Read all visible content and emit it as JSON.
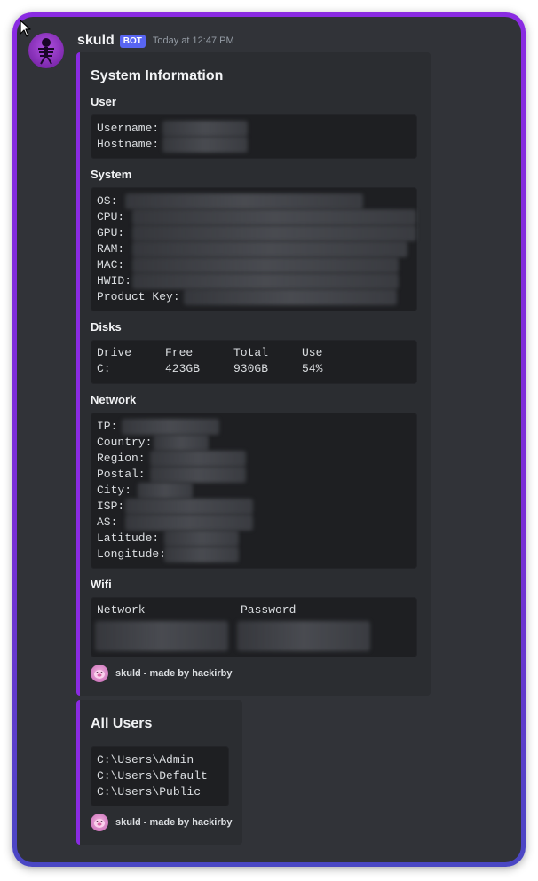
{
  "message": {
    "username": "skuld",
    "badge": "BOT",
    "timestamp": "Today at 12:47 PM"
  },
  "embed1": {
    "title": "System Information",
    "user": {
      "name": "User",
      "lines": [
        "Username:",
        "Hostname:"
      ]
    },
    "system": {
      "name": "System",
      "lines": [
        "OS:",
        "CPU:",
        "GPU:",
        "RAM:",
        "MAC:",
        "HWID:",
        "Product Key:"
      ]
    },
    "disks": {
      "name": "Disks",
      "headers": [
        "Drive",
        "Free",
        "Total",
        "Use"
      ],
      "row": [
        "C:",
        "423GB",
        "930GB",
        "54%"
      ]
    },
    "network": {
      "name": "Network",
      "lines": [
        "IP:",
        "Country:",
        "Region:",
        "Postal:",
        "City:",
        "ISP:",
        "AS:",
        "Latitude:",
        "Longitude:"
      ]
    },
    "wifi": {
      "name": "Wifi",
      "headers": [
        "Network",
        "Password"
      ]
    },
    "footer": "skuld - made by hackirby"
  },
  "embed2": {
    "title": "All Users",
    "lines": [
      "C:\\Users\\Admin",
      "C:\\Users\\Default",
      "C:\\Users\\Public"
    ],
    "footer": "skuld - made by hackirby"
  },
  "colors": {
    "accent": "#8a2be2",
    "background": "#313338",
    "embed_bg": "#2b2d31",
    "code_bg": "#1e1f22",
    "badge": "#5865f2"
  }
}
